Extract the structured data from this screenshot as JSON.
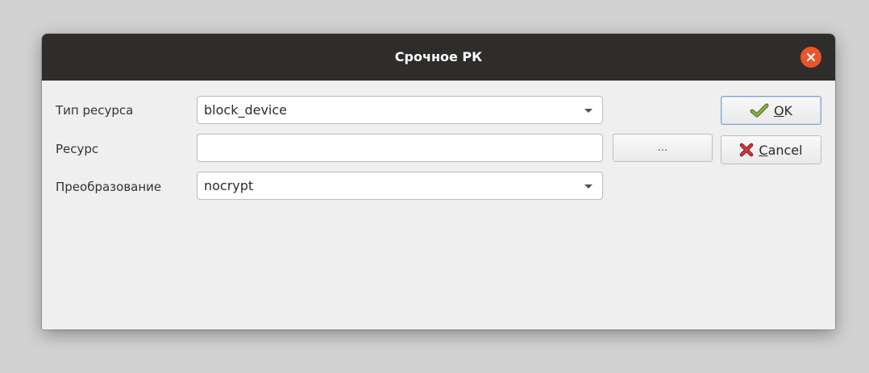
{
  "dialog": {
    "title": "Срочное РК",
    "close_icon": "close-icon"
  },
  "form": {
    "resource_type": {
      "label": "Тип ресурса",
      "value": "block_device"
    },
    "resource": {
      "label": "Ресурс",
      "value": "",
      "browse_label": "..."
    },
    "transform": {
      "label": "Преобразование",
      "value": "nocrypt"
    }
  },
  "buttons": {
    "ok": {
      "mnemonic": "O",
      "rest": "K",
      "icon": "checkmark-icon"
    },
    "cancel": {
      "mnemonic": "C",
      "rest": "ancel",
      "icon": "red-x-icon"
    }
  },
  "colors": {
    "titlebar": "#2e2d2b",
    "close_button": "#e9542a",
    "dialog_background": "#efefef",
    "ok_icon": "#6a8f3a",
    "cancel_icon": "#c0262c"
  }
}
